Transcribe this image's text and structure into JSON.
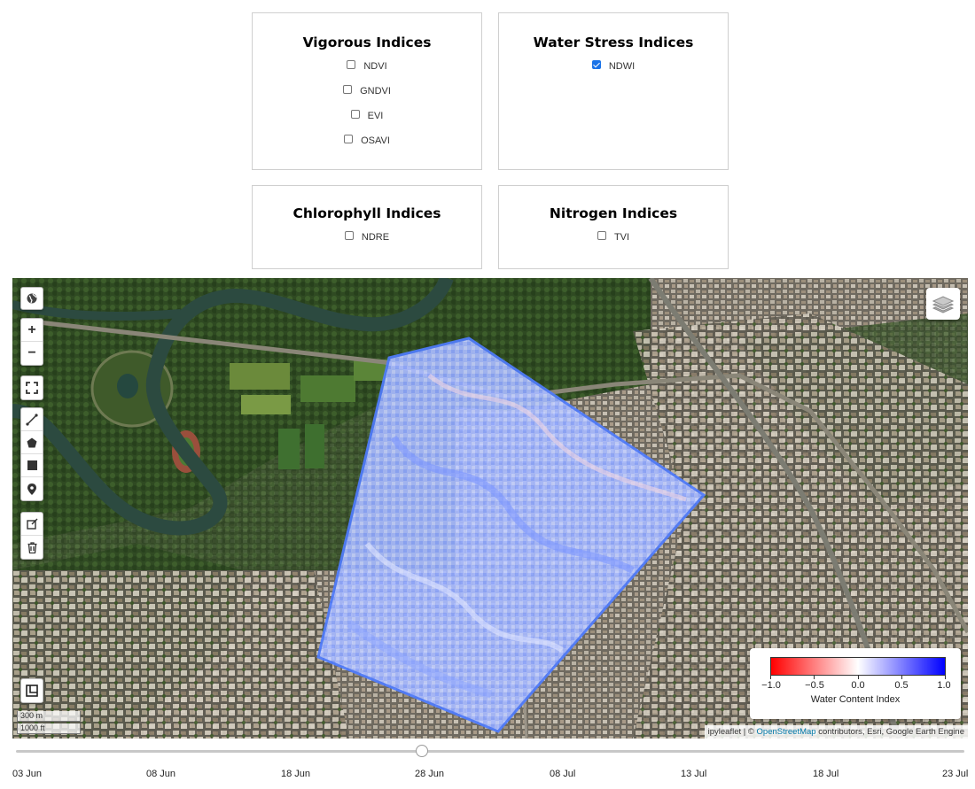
{
  "panels": {
    "vigorous": {
      "title": "Vigorous Indices",
      "options": [
        {
          "label": "NDVI",
          "checked": false
        },
        {
          "label": "GNDVI",
          "checked": false
        },
        {
          "label": "EVI",
          "checked": false
        },
        {
          "label": "OSAVI",
          "checked": false
        }
      ]
    },
    "water": {
      "title": "Water Stress Indices",
      "options": [
        {
          "label": "NDWI",
          "checked": true
        }
      ]
    },
    "chlorophyll": {
      "title": "Chlorophyll Indices",
      "options": [
        {
          "label": "NDRE",
          "checked": false
        }
      ]
    },
    "nitrogen": {
      "title": "Nitrogen Indices",
      "options": [
        {
          "label": "TVI",
          "checked": false
        }
      ]
    }
  },
  "map": {
    "controls": {
      "zoom_in": "+",
      "zoom_out": "−"
    },
    "legend": {
      "title": "Water Content Index",
      "ticks": [
        "−1.0",
        "−0.5",
        "0.0",
        "0.5",
        "1.0"
      ],
      "colors": {
        "min": "#ff0000",
        "mid": "#ffffff",
        "max": "#0000ff"
      }
    },
    "scale": {
      "metric": "300 m",
      "imperial": "1000 ft"
    },
    "attribution": {
      "prefix": "ipyleaflet | © ",
      "link": "OpenStreetMap",
      "suffix": " contributors, Esri, Google Earth Engine"
    },
    "overlay_color": "#5f86ff"
  },
  "timeline": {
    "dates": [
      "03 Jun",
      "08 Jun",
      "18 Jun",
      "28 Jun",
      "08 Jul",
      "13 Jul",
      "18 Jul",
      "23 Jul"
    ],
    "selected": "28 Jun"
  }
}
